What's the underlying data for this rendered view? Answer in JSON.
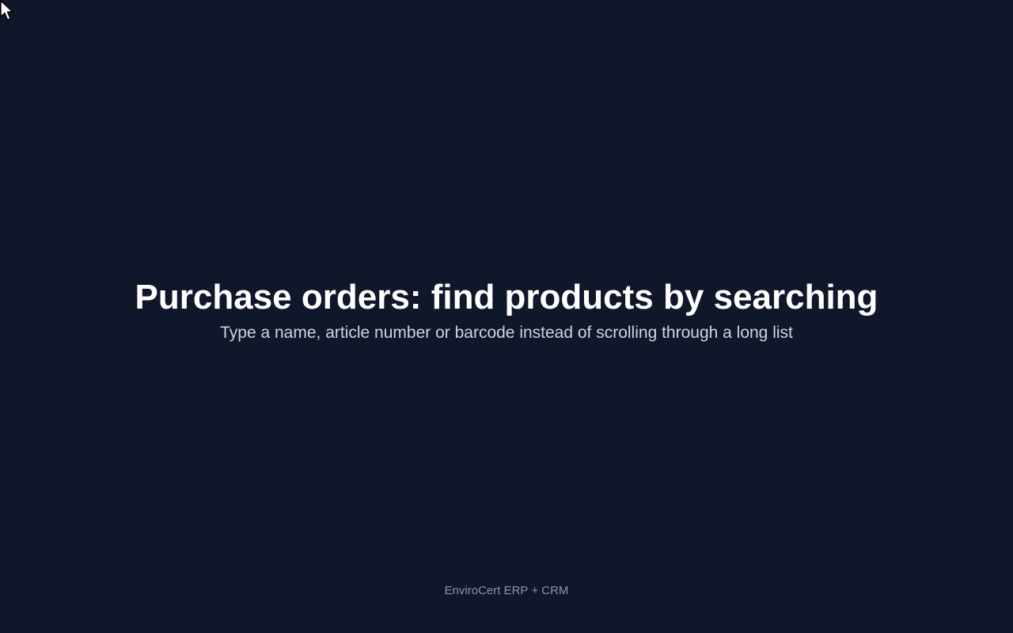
{
  "slide": {
    "headline": "Purchase orders: find products by searching",
    "subheadline": "Type a name, article number or barcode instead of scrolling through a long list",
    "footer": "EnviroCert ERP + CRM"
  },
  "colors": {
    "background": "#11172a",
    "headline": "#ffffff",
    "subheadline": "#cfd4dc",
    "footer": "#8d93a3"
  },
  "icons": {
    "pointer": "mouse-pointer-icon"
  }
}
